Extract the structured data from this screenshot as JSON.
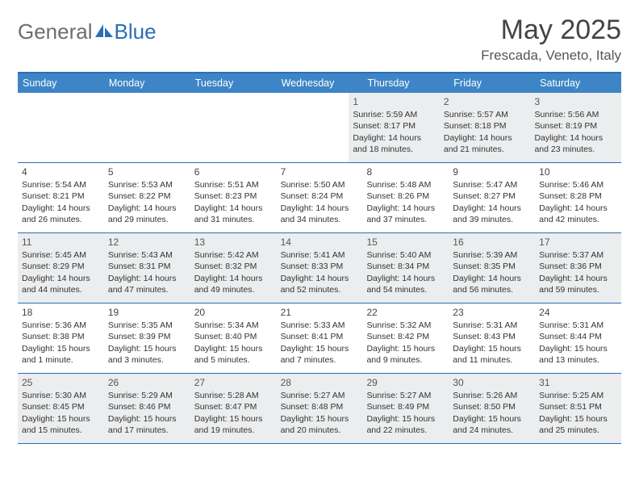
{
  "brand": {
    "part1": "General",
    "part2": "Blue"
  },
  "title": "May 2025",
  "location": "Frescada, Veneto, Italy",
  "weekdays": [
    "Sunday",
    "Monday",
    "Tuesday",
    "Wednesday",
    "Thursday",
    "Friday",
    "Saturday"
  ],
  "weeks": [
    [
      null,
      null,
      null,
      null,
      {
        "n": "1",
        "sunrise": "5:59 AM",
        "sunset": "8:17 PM",
        "daylight": "14 hours and 18 minutes."
      },
      {
        "n": "2",
        "sunrise": "5:57 AM",
        "sunset": "8:18 PM",
        "daylight": "14 hours and 21 minutes."
      },
      {
        "n": "3",
        "sunrise": "5:56 AM",
        "sunset": "8:19 PM",
        "daylight": "14 hours and 23 minutes."
      }
    ],
    [
      {
        "n": "4",
        "sunrise": "5:54 AM",
        "sunset": "8:21 PM",
        "daylight": "14 hours and 26 minutes."
      },
      {
        "n": "5",
        "sunrise": "5:53 AM",
        "sunset": "8:22 PM",
        "daylight": "14 hours and 29 minutes."
      },
      {
        "n": "6",
        "sunrise": "5:51 AM",
        "sunset": "8:23 PM",
        "daylight": "14 hours and 31 minutes."
      },
      {
        "n": "7",
        "sunrise": "5:50 AM",
        "sunset": "8:24 PM",
        "daylight": "14 hours and 34 minutes."
      },
      {
        "n": "8",
        "sunrise": "5:48 AM",
        "sunset": "8:26 PM",
        "daylight": "14 hours and 37 minutes."
      },
      {
        "n": "9",
        "sunrise": "5:47 AM",
        "sunset": "8:27 PM",
        "daylight": "14 hours and 39 minutes."
      },
      {
        "n": "10",
        "sunrise": "5:46 AM",
        "sunset": "8:28 PM",
        "daylight": "14 hours and 42 minutes."
      }
    ],
    [
      {
        "n": "11",
        "sunrise": "5:45 AM",
        "sunset": "8:29 PM",
        "daylight": "14 hours and 44 minutes."
      },
      {
        "n": "12",
        "sunrise": "5:43 AM",
        "sunset": "8:31 PM",
        "daylight": "14 hours and 47 minutes."
      },
      {
        "n": "13",
        "sunrise": "5:42 AM",
        "sunset": "8:32 PM",
        "daylight": "14 hours and 49 minutes."
      },
      {
        "n": "14",
        "sunrise": "5:41 AM",
        "sunset": "8:33 PM",
        "daylight": "14 hours and 52 minutes."
      },
      {
        "n": "15",
        "sunrise": "5:40 AM",
        "sunset": "8:34 PM",
        "daylight": "14 hours and 54 minutes."
      },
      {
        "n": "16",
        "sunrise": "5:39 AM",
        "sunset": "8:35 PM",
        "daylight": "14 hours and 56 minutes."
      },
      {
        "n": "17",
        "sunrise": "5:37 AM",
        "sunset": "8:36 PM",
        "daylight": "14 hours and 59 minutes."
      }
    ],
    [
      {
        "n": "18",
        "sunrise": "5:36 AM",
        "sunset": "8:38 PM",
        "daylight": "15 hours and 1 minute."
      },
      {
        "n": "19",
        "sunrise": "5:35 AM",
        "sunset": "8:39 PM",
        "daylight": "15 hours and 3 minutes."
      },
      {
        "n": "20",
        "sunrise": "5:34 AM",
        "sunset": "8:40 PM",
        "daylight": "15 hours and 5 minutes."
      },
      {
        "n": "21",
        "sunrise": "5:33 AM",
        "sunset": "8:41 PM",
        "daylight": "15 hours and 7 minutes."
      },
      {
        "n": "22",
        "sunrise": "5:32 AM",
        "sunset": "8:42 PM",
        "daylight": "15 hours and 9 minutes."
      },
      {
        "n": "23",
        "sunrise": "5:31 AM",
        "sunset": "8:43 PM",
        "daylight": "15 hours and 11 minutes."
      },
      {
        "n": "24",
        "sunrise": "5:31 AM",
        "sunset": "8:44 PM",
        "daylight": "15 hours and 13 minutes."
      }
    ],
    [
      {
        "n": "25",
        "sunrise": "5:30 AM",
        "sunset": "8:45 PM",
        "daylight": "15 hours and 15 minutes."
      },
      {
        "n": "26",
        "sunrise": "5:29 AM",
        "sunset": "8:46 PM",
        "daylight": "15 hours and 17 minutes."
      },
      {
        "n": "27",
        "sunrise": "5:28 AM",
        "sunset": "8:47 PM",
        "daylight": "15 hours and 19 minutes."
      },
      {
        "n": "28",
        "sunrise": "5:27 AM",
        "sunset": "8:48 PM",
        "daylight": "15 hours and 20 minutes."
      },
      {
        "n": "29",
        "sunrise": "5:27 AM",
        "sunset": "8:49 PM",
        "daylight": "15 hours and 22 minutes."
      },
      {
        "n": "30",
        "sunrise": "5:26 AM",
        "sunset": "8:50 PM",
        "daylight": "15 hours and 24 minutes."
      },
      {
        "n": "31",
        "sunrise": "5:25 AM",
        "sunset": "8:51 PM",
        "daylight": "15 hours and 25 minutes."
      }
    ]
  ],
  "labels": {
    "sunrise": "Sunrise: ",
    "sunset": "Sunset: ",
    "daylight": "Daylight: "
  }
}
